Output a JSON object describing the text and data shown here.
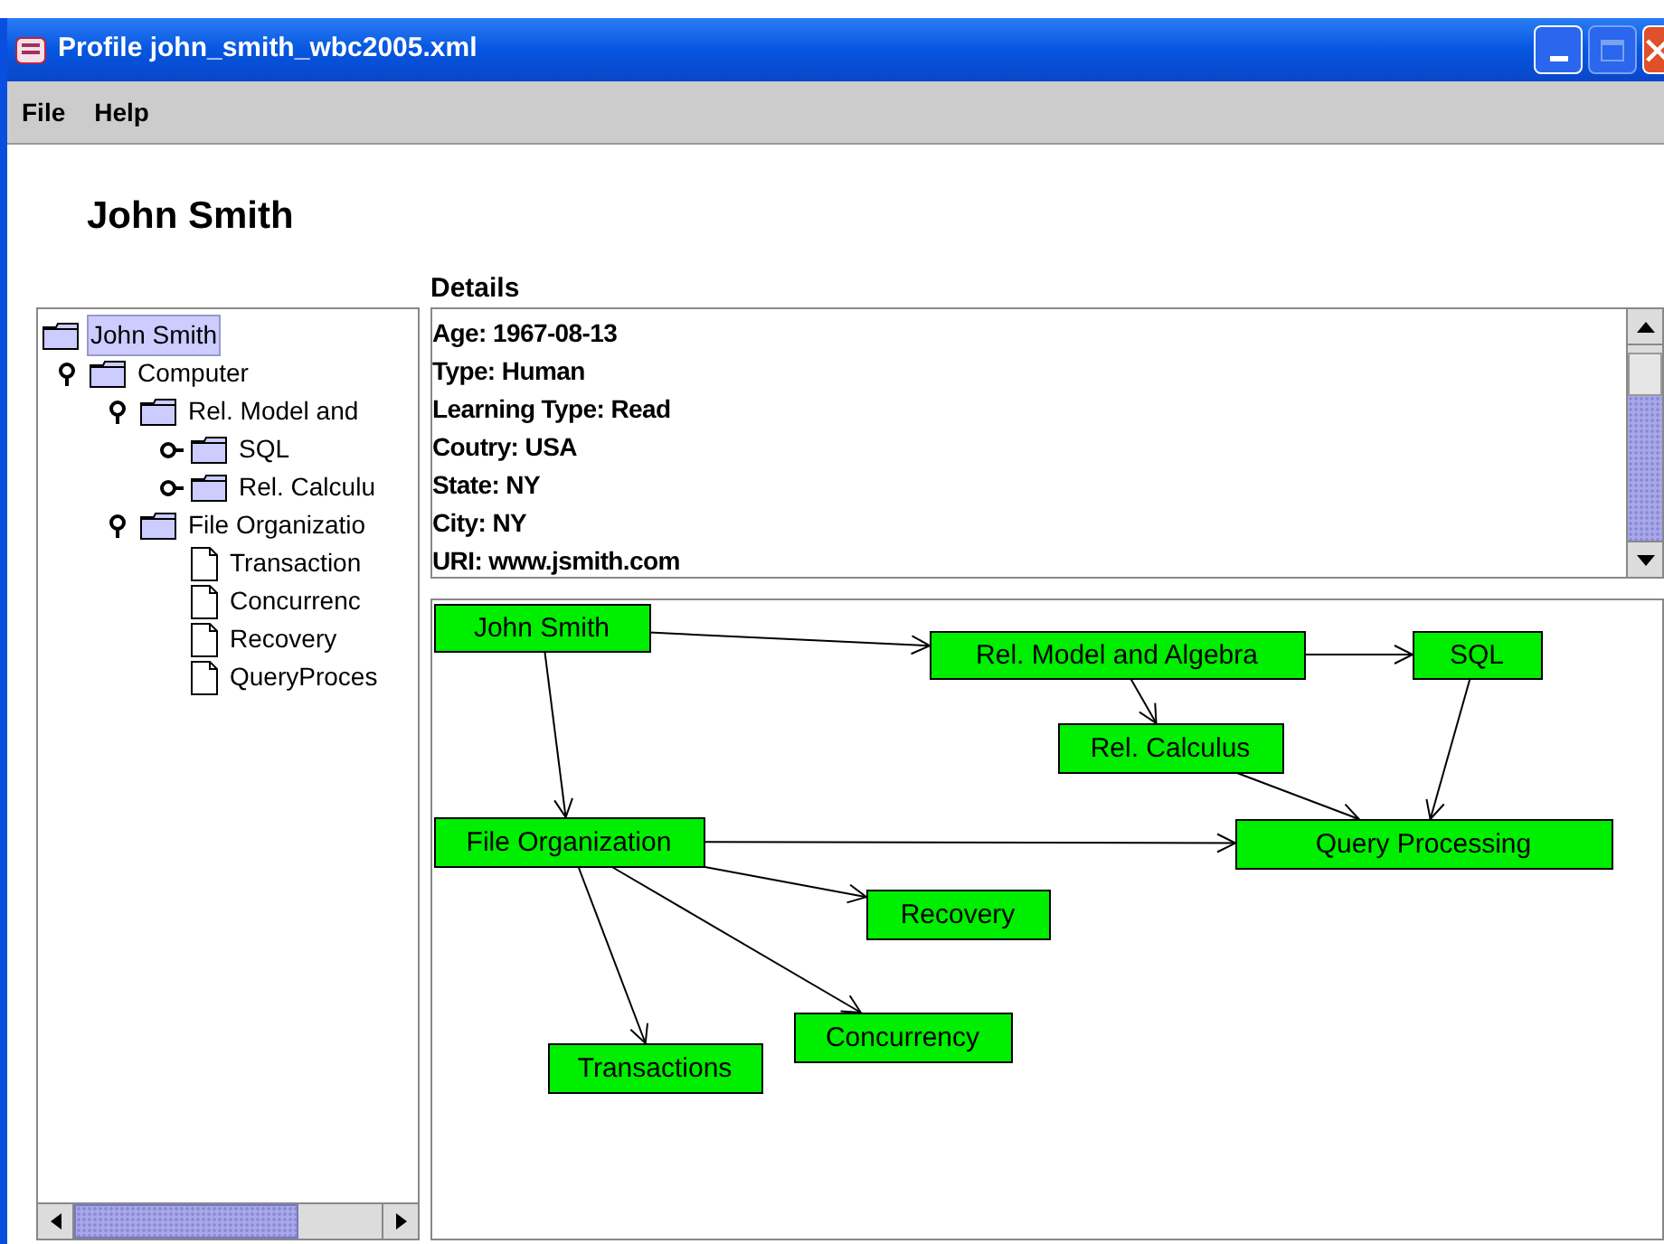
{
  "window": {
    "title": "Profile john_smith_wbc2005.xml"
  },
  "menu": [
    "File",
    "Help"
  ],
  "heading": "John Smith",
  "tree": [
    {
      "label": "John Smith",
      "kind": "folder",
      "selected": true,
      "children": [
        {
          "label": "Computer",
          "kind": "folder",
          "selected": false,
          "expanded": true,
          "children": [
            {
              "label": "Rel. Model and",
              "kind": "folder",
              "selected": false,
              "expanded": true,
              "children": [
                {
                  "label": "SQL",
                  "kind": "folder",
                  "selected": false,
                  "expanded": false
                },
                {
                  "label": "Rel. Calculu",
                  "kind": "folder",
                  "selected": false,
                  "expanded": false
                }
              ]
            },
            {
              "label": "File Organizatio",
              "kind": "folder",
              "selected": false,
              "expanded": true,
              "children": [
                {
                  "label": "Transaction",
                  "kind": "document",
                  "selected": false
                },
                {
                  "label": "Concurrenc",
                  "kind": "document",
                  "selected": false
                },
                {
                  "label": "Recovery",
                  "kind": "document",
                  "selected": false
                },
                {
                  "label": "QueryProces",
                  "kind": "document",
                  "selected": false
                }
              ]
            }
          ]
        }
      ]
    }
  ],
  "details": {
    "title": "Details",
    "lines": [
      "Age: 1967-08-13",
      "Type: Human",
      "Learning Type: Read",
      "Coutry: USA",
      "State: NY",
      "City: NY",
      "URI: www.jsmith.com"
    ]
  },
  "graph": {
    "nodes": [
      {
        "label": "John Smith"
      },
      {
        "label": "Rel. Model and Algebra"
      },
      {
        "label": "SQL"
      },
      {
        "label": "Rel. Calculus"
      },
      {
        "label": "File Organization"
      },
      {
        "label": "Query Processing"
      },
      {
        "label": "Recovery"
      },
      {
        "label": "Concurrency"
      },
      {
        "label": "Transactions"
      }
    ]
  }
}
